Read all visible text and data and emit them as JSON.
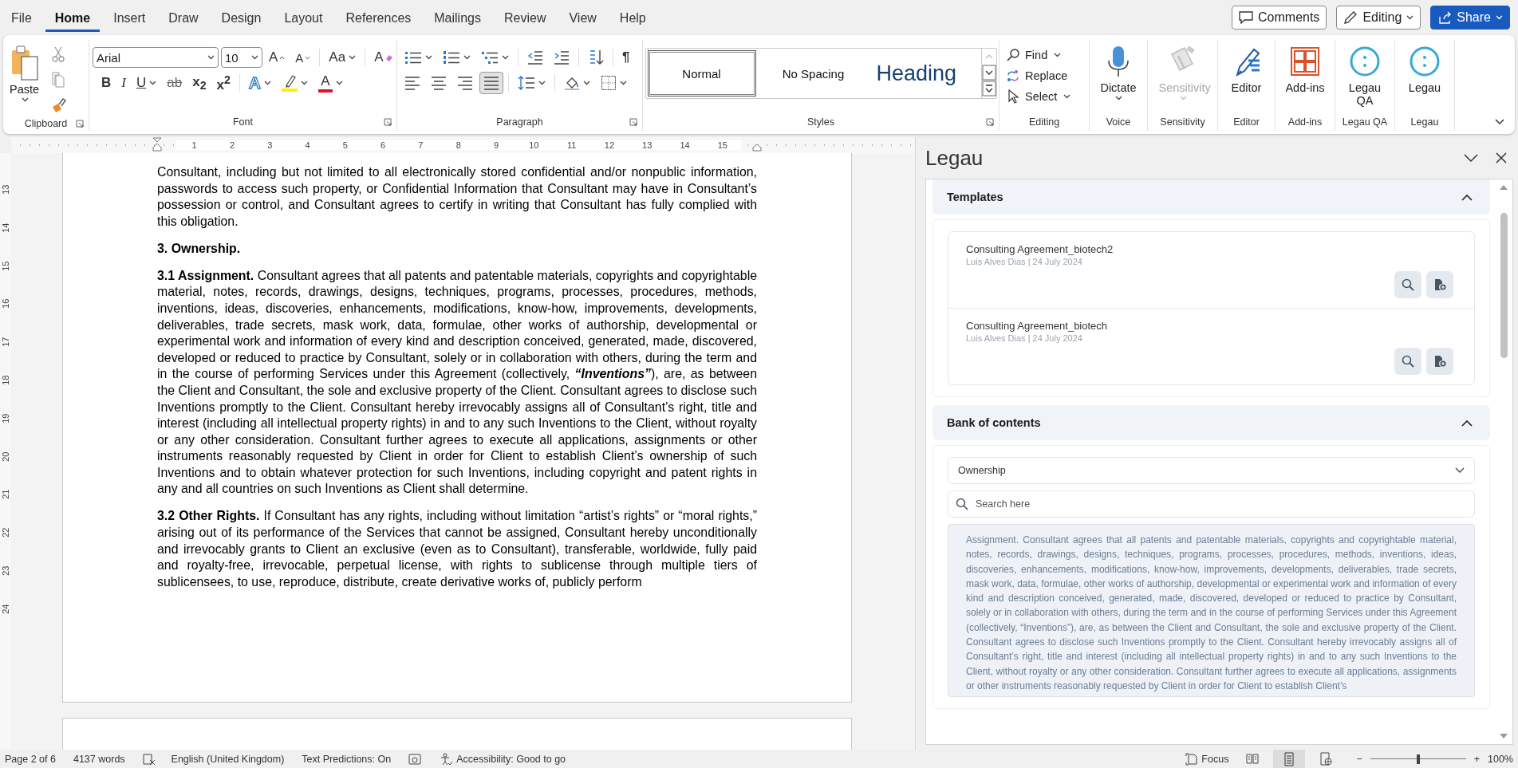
{
  "menu_tabs": [
    {
      "label": "File",
      "selected": false
    },
    {
      "label": "Home",
      "selected": true
    },
    {
      "label": "Insert",
      "selected": false
    },
    {
      "label": "Draw",
      "selected": false
    },
    {
      "label": "Design",
      "selected": false
    },
    {
      "label": "Layout",
      "selected": false
    },
    {
      "label": "References",
      "selected": false
    },
    {
      "label": "Mailings",
      "selected": false
    },
    {
      "label": "Review",
      "selected": false
    },
    {
      "label": "View",
      "selected": false
    },
    {
      "label": "Help",
      "selected": false
    }
  ],
  "header_buttons": [
    {
      "kind": "comments",
      "label": "Comments"
    },
    {
      "kind": "editing",
      "label": "Editing"
    },
    {
      "kind": "share",
      "label": "Share"
    }
  ],
  "ribbon": {
    "clipboard": {
      "title": "Clipboard",
      "paste": "Paste"
    },
    "font": {
      "title": "Font",
      "font_name": "Arial",
      "font_size": "10",
      "tools": [
        {
          "kind": "grow",
          "glyph": "A"
        },
        {
          "kind": "shrink",
          "glyph": "A"
        },
        {
          "kind": "case",
          "glyph": "Aa"
        },
        {
          "kind": "clear",
          "glyph": "A"
        }
      ],
      "styles": [
        {
          "kind": "bold",
          "glyph": "B"
        },
        {
          "kind": "italic",
          "glyph": "I"
        },
        {
          "kind": "underline",
          "glyph": "U"
        },
        {
          "kind": "strike",
          "glyph": "ab"
        },
        {
          "kind": "sub",
          "glyph": "x$_{2}$"
        },
        {
          "kind": "sup",
          "glyph": "x$^{2}$"
        },
        {
          "kind": "effects",
          "glyph": "A"
        },
        {
          "kind": "highlight"
        },
        {
          "kind": "color",
          "glyph": "A"
        }
      ]
    },
    "paragraph": {
      "title": "Paragraph",
      "show_marks": "¶",
      "align_buttons": [
        {
          "kind": "left",
          "selected": false
        },
        {
          "kind": "center",
          "selected": false
        },
        {
          "kind": "right",
          "selected": false
        },
        {
          "kind": "justify",
          "selected": true
        }
      ]
    },
    "styles": {
      "title": "Styles",
      "items": [
        {
          "kind": "body",
          "label": "Normal",
          "selected": true
        },
        {
          "kind": "body",
          "label": "No Spacing",
          "selected": false
        },
        {
          "kind": "heading",
          "label": "Heading",
          "selected": false
        }
      ]
    },
    "editing": {
      "title": "Editing",
      "items": [
        {
          "kind": "find",
          "label": "Find"
        },
        {
          "kind": "replace",
          "label": "Replace"
        },
        {
          "kind": "select",
          "label": "Select"
        }
      ]
    },
    "big_groups": [
      {
        "kind": "dictate",
        "label": "Dictate",
        "title": "Voice",
        "disabled": false
      },
      {
        "kind": "sensitivity",
        "label": "Sensitivity",
        "title": "Sensitivity",
        "disabled": true
      },
      {
        "kind": "editor",
        "label": "Editor",
        "title": "Editor",
        "disabled": false
      },
      {
        "kind": "addins",
        "label": "Add-ins",
        "title": "Add-ins",
        "disabled": false
      },
      {
        "kind": "legau",
        "label": "Legau QA",
        "title": "Legau QA",
        "disabled": false
      },
      {
        "kind": "legau",
        "label": "Legau",
        "title": "Legau",
        "disabled": false
      }
    ]
  },
  "rulers": {
    "horizontal": [
      "1",
      "2",
      "3",
      "4",
      "5",
      "6",
      "7",
      "8",
      "9",
      "10",
      "11",
      "12",
      "13",
      "14",
      "15"
    ],
    "vertical": [
      "13",
      "14",
      "15",
      "16",
      "17",
      "18",
      "19",
      "20",
      "21",
      "22",
      "23",
      "24"
    ]
  },
  "document": {
    "paragraphs": [
      {
        "kind": "body",
        "text": "Consultant, including but not limited to all electronically stored confidential and/or nonpublic information, passwords to access such property, or Confidential Information that Consultant may have in Consultant’s possession or control, and Consultant agrees to certify in writing that Consultant has fully complied with this obligation."
      },
      {
        "kind": "heading",
        "text": "3. Ownership."
      },
      {
        "kind": "body",
        "text": "**3.1  Assignment.** Consultant agrees that all patents and patentable materials, copyrights and copyrightable material, notes, records, drawings, designs, techniques, programs, processes, procedures, methods, inventions, ideas, discoveries, enhancements, modifications, know-how, improvements, developments, deliverables, trade secrets, mask work, data, formulae, other works of authorship, developmental or experimental work and information of every kind and description conceived, generated, made, discovered, developed or reduced to practice by Consultant, solely or in collaboration with others, during the term and in the course of performing Services under this Agreement (collectively, *“Inventions”*), are, as between the Client and Consultant, the sole and exclusive property of the Client. Consultant agrees to disclose such Inventions promptly to the Client. Consultant hereby irrevocably assigns all of Consultant’s right, title and interest (including all intellectual property rights) in and to any such Inventions to the Client, without royalty or any other consideration. Consultant further agrees to execute all applications, assignments or other instruments reasonably requested by Client in order for Client to establish Client’s ownership of such Inventions and to obtain whatever protection for such Inventions, including copyright and patent rights in any and all countries on such Inventions as Client shall determine."
      },
      {
        "kind": "body",
        "text": "**3.2 Other Rights.** If Consultant has any rights, including without limitation “artist’s rights” or “moral rights,” arising out of its performance of the Services that cannot be assigned, Consultant hereby unconditionally and irrevocably grants to Client an exclusive (even as to Consultant), transferable, worldwide, fully paid and royalty-free, irrevocable, perpetual license, with rights to sublicense through multiple tiers of sublicensees, to use, reproduce, distribute, create derivative works of, publicly perform"
      }
    ]
  },
  "task_pane": {
    "title": "Legau",
    "sections": [
      {
        "kind": "templates",
        "title": "Templates",
        "expanded": true,
        "items": [
          {
            "name": "Consulting Agreement_biotech2",
            "meta": "Luis Alves Dias | 24 July 2024"
          },
          {
            "name": "Consulting Agreement_biotech",
            "meta": "Luis Alves Dias | 24 July 2024"
          }
        ]
      },
      {
        "kind": "bank",
        "title": "Bank of contents",
        "expanded": true,
        "category": "Ownership",
        "search_placeholder": "Search here",
        "content": "Assignment. Consultant agrees that all patents and patentable materials, copyrights and copyrightable material, notes, records, drawings, designs, techniques, programs, processes, procedures, methods, inventions, ideas, discoveries, enhancements, modifications, know-how, improvements, developments, deliverables, trade secrets, mask work, data, formulae, other works of authorship, developmental or experimental work and information of every kind and description conceived, generated, made, discovered, developed or reduced to practice by Consultant, solely or in collaboration with others, during the term and in the course of performing Services under this Agreement (collectively, “Inventions”), are, as between the Client and Consultant, the sole and exclusive property of the Client. Consultant agrees to disclose such Inventions promptly to the Client. Consultant hereby irrevocably assigns all of Consultant’s right, title and interest (including all intellectual property rights) in and to any such Inventions to the Client, without royalty or any other consideration. Consultant further agrees to execute all applications, assignments or other instruments reasonably requested by Client in order for Client to establish Client’s"
      }
    ]
  },
  "status_bar": {
    "page": "Page 2 of 6",
    "words": "4137 words",
    "language": "English (United Kingdom)",
    "predictions": "Text Predictions: On",
    "accessibility": "Accessibility: Good to go",
    "focus": "Focus",
    "views": [
      {
        "kind": "read",
        "selected": false
      },
      {
        "kind": "print",
        "selected": true
      },
      {
        "kind": "web",
        "selected": false
      }
    ],
    "zoom_out": "−",
    "zoom_in": "+",
    "zoom": {
      "level": 0.5,
      "reading": "100%"
    }
  }
}
